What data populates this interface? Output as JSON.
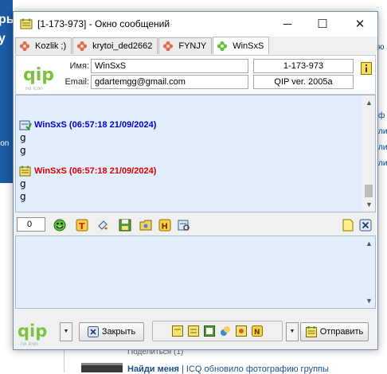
{
  "background": {
    "left_texts": [
      "ры",
      "у",
      "lon"
    ],
    "right_texts": [
      "ю",
      "ф",
      "лис",
      "лис",
      "лис"
    ],
    "bottom_text1": "Поделиться (1)",
    "bottom_link": "Найди меня",
    "bottom_rest": " | ICQ обновило фотографию группы"
  },
  "window": {
    "title": "[1-173-973] - Окно сообщений",
    "min_glyph": "─",
    "max_glyph": "☐",
    "close_glyph": "✕"
  },
  "tabs": [
    {
      "label": "Kozlik ;)",
      "icon": "flower-icon"
    },
    {
      "label": "krytoi_ded2662",
      "icon": "flower-icon"
    },
    {
      "label": "FYNJY",
      "icon": "flower-icon"
    },
    {
      "label": "WinSxS",
      "icon": "green-flower-icon",
      "active": true
    }
  ],
  "contact": {
    "name_label": "Имя:",
    "name": "WinSxS",
    "email_label": "Email:",
    "email": "gdartemgg@gmail.com",
    "uin": "1-173-973",
    "client": "QIP ver. 2005a",
    "logo_sub": "no icon"
  },
  "messages": [
    {
      "header": "WinSxS (06:57:18 21/09/2024)",
      "color": "#0000cc",
      "lines": [
        "g",
        "g"
      ]
    },
    {
      "header": "WinSxS (06:57:18 21/09/2024)",
      "color": "#e00000",
      "lines": [
        "g",
        "g"
      ]
    }
  ],
  "toolbar": {
    "char_count": "0"
  },
  "bottom": {
    "close_label": "Закрыть",
    "send_label": "Отправить",
    "logo_sub": "no icon"
  },
  "colors": {
    "chat_bg": "#e2eefb",
    "accent": "#1c5aa3"
  }
}
